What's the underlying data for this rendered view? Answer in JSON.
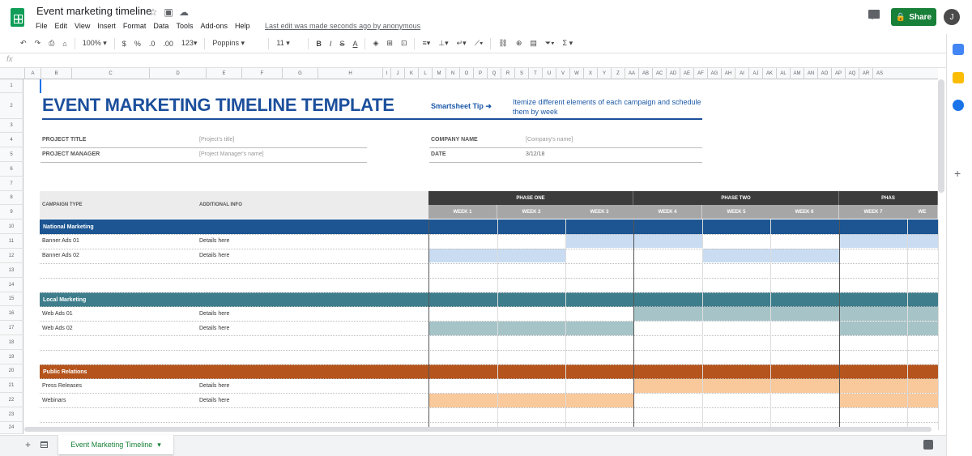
{
  "app": {
    "title": "Event marketing timeline",
    "last_edit": "Last edit was made seconds ago by anonymous",
    "share_label": "Share",
    "avatar_letter": "J"
  },
  "menu": [
    "File",
    "Edit",
    "View",
    "Insert",
    "Format",
    "Data",
    "Tools",
    "Add-ons",
    "Help"
  ],
  "toolbar": {
    "zoom": "100%",
    "currency": "$",
    "percent": "%",
    "dec_less": ".0",
    "dec_more": ".00",
    "format": "123",
    "font": "Poppins",
    "size": "11",
    "bold": "B",
    "italic": "I",
    "strike": "S",
    "text_color": "A",
    "sum": "Σ"
  },
  "formula_bar": {
    "fx": "fx",
    "value": ""
  },
  "columns": [
    "A",
    "B",
    "C",
    "D",
    "E",
    "F",
    "G",
    "H",
    "I",
    "J",
    "K",
    "L",
    "M",
    "N",
    "O",
    "P",
    "Q",
    "R",
    "S",
    "T",
    "U",
    "V",
    "W",
    "X",
    "Y",
    "Z",
    "AA",
    "AB",
    "AC",
    "AD",
    "AE",
    "AF",
    "AG",
    "AH",
    "AI",
    "AJ",
    "AK",
    "AL",
    "AM",
    "AN",
    "AO",
    "AP",
    "AQ",
    "AR",
    "AS"
  ],
  "rows": [
    "1",
    "2",
    "3",
    "4",
    "5",
    "6",
    "7",
    "8",
    "9",
    "10",
    "11",
    "12",
    "13",
    "14",
    "15",
    "16",
    "17",
    "18",
    "19",
    "20",
    "21",
    "22",
    "23",
    "24"
  ],
  "sheet": {
    "title": "EVENT MARKETING TIMELINE TEMPLATE",
    "tip_label": "Smartsheet Tip ➜",
    "tip_text": "Itemize different elements of each campaign and schedule them by week",
    "project_title_label": "PROJECT TITLE",
    "project_title_value": "[Project's title]",
    "project_manager_label": "PROJECT MANAGER",
    "project_manager_value": "[Project Manager's name]",
    "company_label": "COMPANY NAME",
    "company_value": "[Company's name]",
    "date_label": "DATE",
    "date_value": "3/12/18",
    "campaign_type_header": "CAMPAIGN TYPE",
    "additional_info_header": "ADDITIONAL INFO",
    "phases": [
      "PHASE ONE",
      "PHASE TWO",
      "PHAS"
    ],
    "weeks": [
      "WEEK 1",
      "WEEK 2",
      "WEEK 3",
      "WEEK 4",
      "WEEK 5",
      "WEEK 6",
      "WEEK 7",
      "WE"
    ],
    "groups": [
      {
        "name": "National Marketing",
        "color": "#1c5592",
        "light": "#c9dcf2",
        "items": [
          {
            "name": "Banner Ads 01",
            "info": "Details here"
          },
          {
            "name": "Banner Ads 02",
            "info": "Details here"
          }
        ]
      },
      {
        "name": "Local Marketing",
        "color": "#3e7e8c",
        "light": "#a6c4c8",
        "items": [
          {
            "name": "Web Ads 01",
            "info": "Details here"
          },
          {
            "name": "Web Ads 02",
            "info": "Details here"
          }
        ]
      },
      {
        "name": "Public Relations",
        "color": "#b5541c",
        "light": "#f9c89b",
        "items": [
          {
            "name": "Press Releases",
            "info": "Details here"
          },
          {
            "name": "Webinars",
            "info": "Details here"
          }
        ]
      }
    ]
  },
  "tab": {
    "name": "Event Marketing Timeline"
  }
}
